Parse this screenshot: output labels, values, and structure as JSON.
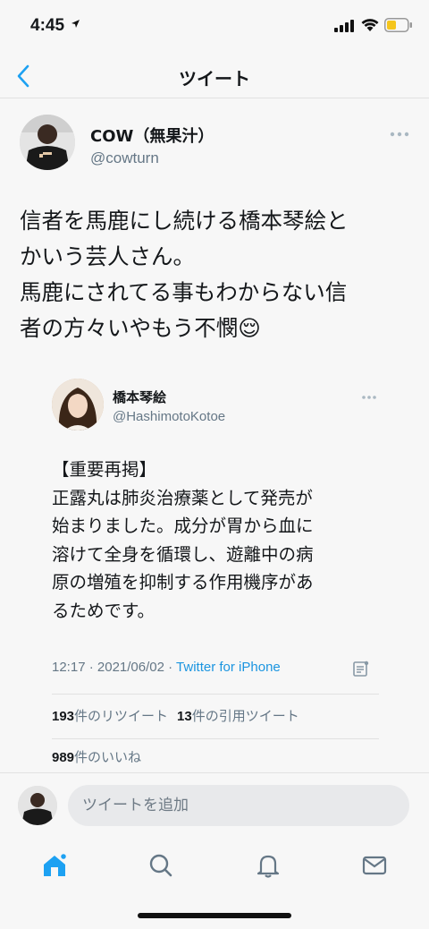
{
  "status": {
    "time": "4:45"
  },
  "nav": {
    "title": "ツイート"
  },
  "tweet": {
    "author_name": "COW（無果汁）",
    "author_handle": "@cowturn",
    "text_lines": [
      "信者を馬鹿にし続ける橋本琴絵と",
      "かいう芸人さん。",
      "馬鹿にされてる事もわからない信",
      "者の方々いやもう不憫😌"
    ]
  },
  "quote": {
    "author_name": "橋本琴絵",
    "author_handle": "@HashimotoKotoe",
    "text_lines": [
      "【重要再掲】",
      "正露丸は肺炎治療薬として発売が",
      "始まりました。成分が胃から血に",
      "溶けて全身を循環し、遊離中の病",
      "原の増殖を抑制する作用機序があ",
      "るためです。"
    ],
    "time": "12:17",
    "separator": " · ",
    "date": "2021/06/02",
    "source": "Twitter for iPhone",
    "retweets_count": "193",
    "retweets_label": "件のリツイート",
    "quote_tweets_count": "13",
    "quote_tweets_label": "件の引用ツイート",
    "likes_count": "989",
    "likes_label": "件のいいね"
  },
  "compose": {
    "placeholder": "ツイートを追加"
  },
  "colors": {
    "accent": "#1da1f2",
    "secondary_text": "#657786",
    "background": "#f7f7f7"
  },
  "tabs": [
    {
      "name": "home-icon",
      "active": true
    },
    {
      "name": "search-icon",
      "active": false
    },
    {
      "name": "notifications-icon",
      "active": false
    },
    {
      "name": "messages-icon",
      "active": false
    }
  ]
}
